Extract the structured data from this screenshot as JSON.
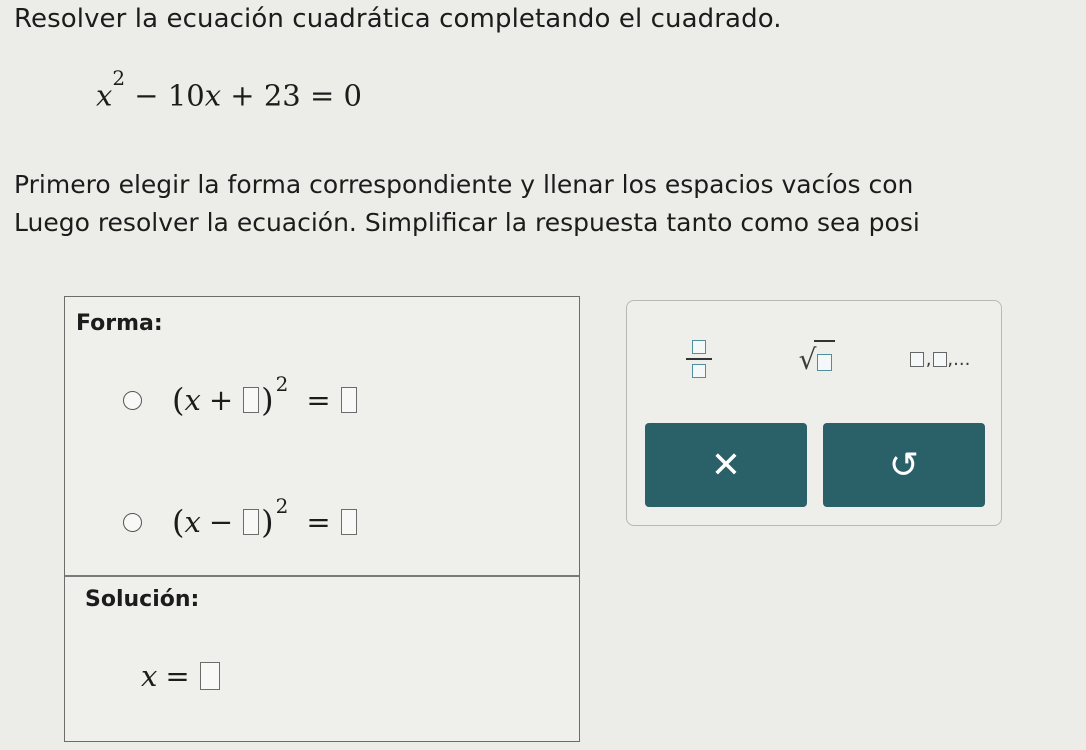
{
  "problem": {
    "heading": "Resolver la ecuación cuadrática completando el cuadrado.",
    "equation": {
      "var": "x",
      "exp": "2",
      "rest": " − 10",
      "var2": "x",
      "tail": " + 23 = 0"
    },
    "instruction_line1": "Primero elegir la forma correspondiente y llenar los espacios vacíos con",
    "instruction_line2": "Luego resolver la ecuación. Simplificar la respuesta tanto como sea posi"
  },
  "answer_panel": {
    "forma_label": "Forma:",
    "options": [
      {
        "open": "(",
        "var": "x",
        "sign": "+",
        "close": ")",
        "exp": "2",
        "equals": "="
      },
      {
        "open": "(",
        "var": "x",
        "sign": "−",
        "close": ")",
        "exp": "2",
        "equals": "="
      }
    ],
    "solucion_label": "Solución:",
    "solution": {
      "var": "x",
      "equals": "="
    }
  },
  "palette": {
    "sqrt_symbol": "√",
    "list_sep": ",",
    "list_ellipsis": ",...",
    "clear_symbol": "✕",
    "undo_symbol": "↺"
  },
  "colors": {
    "button_bg": "#2a6068",
    "accent_box": "#4f8fa0"
  }
}
